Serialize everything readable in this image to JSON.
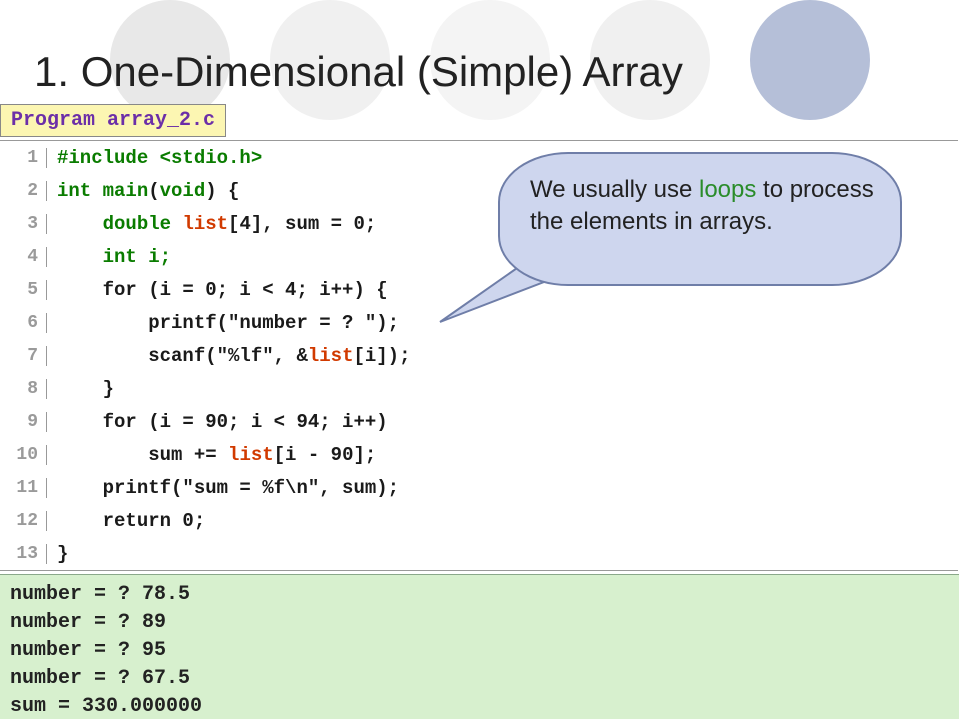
{
  "title": "1. One-Dimensional (Simple) Array",
  "program_label": "Program array_2.c",
  "code": {
    "l1": {
      "a": "#include <stdio.h>"
    },
    "l2": {
      "a": "int main",
      "b": "(",
      "c": "void",
      "d": ") {"
    },
    "l3": {
      "pad": "    ",
      "a": "double ",
      "b": "list",
      "c": "[4], sum = 0;"
    },
    "l4": {
      "pad": "    ",
      "a": "int i;"
    },
    "l5": {
      "pad": "    ",
      "a": "for (i = 0; i < 4; i++) {"
    },
    "l6": {
      "pad": "        ",
      "a": "printf(\"number = ? \");"
    },
    "l7": {
      "pad": "        ",
      "a": "scanf(\"%lf\", &",
      "b": "list",
      "c": "[i]);"
    },
    "l8": {
      "pad": "    ",
      "a": "}"
    },
    "l9": {
      "pad": "    ",
      "a": "for (i = 90; i < 94; i++)"
    },
    "l10": {
      "pad": "        ",
      "a": "sum += ",
      "b": "list",
      "c": "[i - 90];"
    },
    "l11": {
      "pad": "    ",
      "a": "printf(\"sum = %f\\n\", sum);"
    },
    "l12": {
      "pad": "    ",
      "a": "return 0;"
    },
    "l13": {
      "a": "}"
    }
  },
  "line_numbers": [
    "1",
    "2",
    "3",
    "4",
    "5",
    "6",
    "7",
    "8",
    "9",
    "10",
    "11",
    "12",
    "13"
  ],
  "output_lines": [
    "number = ? 78.5",
    "number = ? 89",
    "number = ? 95",
    "number = ? 67.5",
    "sum = 330.000000"
  ],
  "callout": {
    "pre": "We usually use ",
    "loops": "loops",
    "post": " to process the elements in arrays."
  }
}
